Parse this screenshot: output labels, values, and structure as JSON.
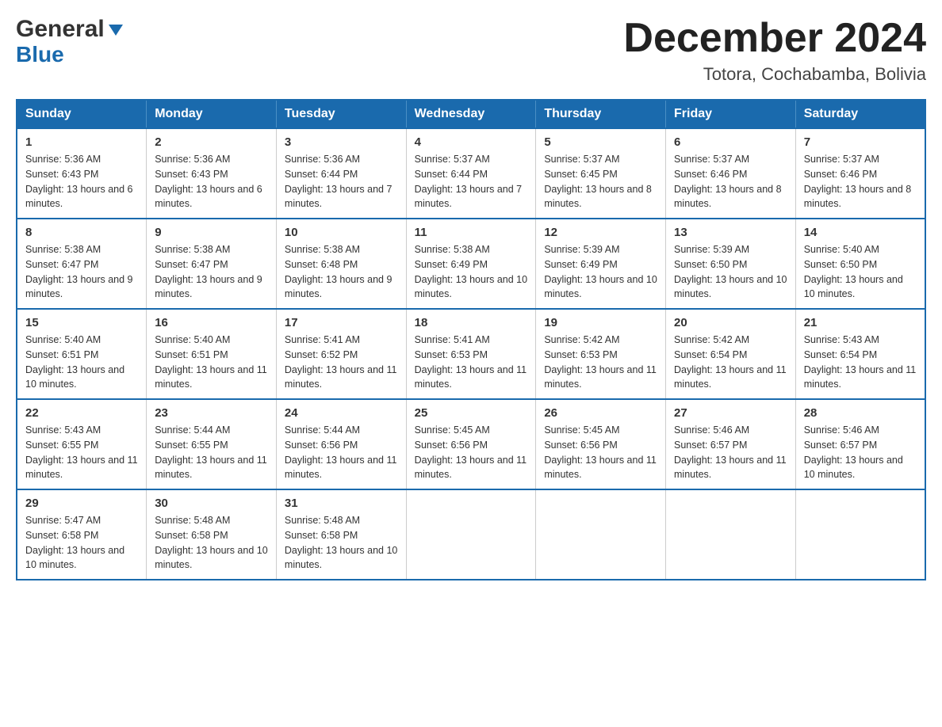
{
  "header": {
    "logo_line1": "General",
    "logo_line2": "Blue",
    "month_title": "December 2024",
    "location": "Totora, Cochabamba, Bolivia"
  },
  "days_of_week": [
    "Sunday",
    "Monday",
    "Tuesday",
    "Wednesday",
    "Thursday",
    "Friday",
    "Saturday"
  ],
  "weeks": [
    [
      {
        "day": "1",
        "sunrise": "5:36 AM",
        "sunset": "6:43 PM",
        "daylight": "13 hours and 6 minutes."
      },
      {
        "day": "2",
        "sunrise": "5:36 AM",
        "sunset": "6:43 PM",
        "daylight": "13 hours and 6 minutes."
      },
      {
        "day": "3",
        "sunrise": "5:36 AM",
        "sunset": "6:44 PM",
        "daylight": "13 hours and 7 minutes."
      },
      {
        "day": "4",
        "sunrise": "5:37 AM",
        "sunset": "6:44 PM",
        "daylight": "13 hours and 7 minutes."
      },
      {
        "day": "5",
        "sunrise": "5:37 AM",
        "sunset": "6:45 PM",
        "daylight": "13 hours and 8 minutes."
      },
      {
        "day": "6",
        "sunrise": "5:37 AM",
        "sunset": "6:46 PM",
        "daylight": "13 hours and 8 minutes."
      },
      {
        "day": "7",
        "sunrise": "5:37 AM",
        "sunset": "6:46 PM",
        "daylight": "13 hours and 8 minutes."
      }
    ],
    [
      {
        "day": "8",
        "sunrise": "5:38 AM",
        "sunset": "6:47 PM",
        "daylight": "13 hours and 9 minutes."
      },
      {
        "day": "9",
        "sunrise": "5:38 AM",
        "sunset": "6:47 PM",
        "daylight": "13 hours and 9 minutes."
      },
      {
        "day": "10",
        "sunrise": "5:38 AM",
        "sunset": "6:48 PM",
        "daylight": "13 hours and 9 minutes."
      },
      {
        "day": "11",
        "sunrise": "5:38 AM",
        "sunset": "6:49 PM",
        "daylight": "13 hours and 10 minutes."
      },
      {
        "day": "12",
        "sunrise": "5:39 AM",
        "sunset": "6:49 PM",
        "daylight": "13 hours and 10 minutes."
      },
      {
        "day": "13",
        "sunrise": "5:39 AM",
        "sunset": "6:50 PM",
        "daylight": "13 hours and 10 minutes."
      },
      {
        "day": "14",
        "sunrise": "5:40 AM",
        "sunset": "6:50 PM",
        "daylight": "13 hours and 10 minutes."
      }
    ],
    [
      {
        "day": "15",
        "sunrise": "5:40 AM",
        "sunset": "6:51 PM",
        "daylight": "13 hours and 10 minutes."
      },
      {
        "day": "16",
        "sunrise": "5:40 AM",
        "sunset": "6:51 PM",
        "daylight": "13 hours and 11 minutes."
      },
      {
        "day": "17",
        "sunrise": "5:41 AM",
        "sunset": "6:52 PM",
        "daylight": "13 hours and 11 minutes."
      },
      {
        "day": "18",
        "sunrise": "5:41 AM",
        "sunset": "6:53 PM",
        "daylight": "13 hours and 11 minutes."
      },
      {
        "day": "19",
        "sunrise": "5:42 AM",
        "sunset": "6:53 PM",
        "daylight": "13 hours and 11 minutes."
      },
      {
        "day": "20",
        "sunrise": "5:42 AM",
        "sunset": "6:54 PM",
        "daylight": "13 hours and 11 minutes."
      },
      {
        "day": "21",
        "sunrise": "5:43 AM",
        "sunset": "6:54 PM",
        "daylight": "13 hours and 11 minutes."
      }
    ],
    [
      {
        "day": "22",
        "sunrise": "5:43 AM",
        "sunset": "6:55 PM",
        "daylight": "13 hours and 11 minutes."
      },
      {
        "day": "23",
        "sunrise": "5:44 AM",
        "sunset": "6:55 PM",
        "daylight": "13 hours and 11 minutes."
      },
      {
        "day": "24",
        "sunrise": "5:44 AM",
        "sunset": "6:56 PM",
        "daylight": "13 hours and 11 minutes."
      },
      {
        "day": "25",
        "sunrise": "5:45 AM",
        "sunset": "6:56 PM",
        "daylight": "13 hours and 11 minutes."
      },
      {
        "day": "26",
        "sunrise": "5:45 AM",
        "sunset": "6:56 PM",
        "daylight": "13 hours and 11 minutes."
      },
      {
        "day": "27",
        "sunrise": "5:46 AM",
        "sunset": "6:57 PM",
        "daylight": "13 hours and 11 minutes."
      },
      {
        "day": "28",
        "sunrise": "5:46 AM",
        "sunset": "6:57 PM",
        "daylight": "13 hours and 10 minutes."
      }
    ],
    [
      {
        "day": "29",
        "sunrise": "5:47 AM",
        "sunset": "6:58 PM",
        "daylight": "13 hours and 10 minutes."
      },
      {
        "day": "30",
        "sunrise": "5:48 AM",
        "sunset": "6:58 PM",
        "daylight": "13 hours and 10 minutes."
      },
      {
        "day": "31",
        "sunrise": "5:48 AM",
        "sunset": "6:58 PM",
        "daylight": "13 hours and 10 minutes."
      },
      null,
      null,
      null,
      null
    ]
  ]
}
